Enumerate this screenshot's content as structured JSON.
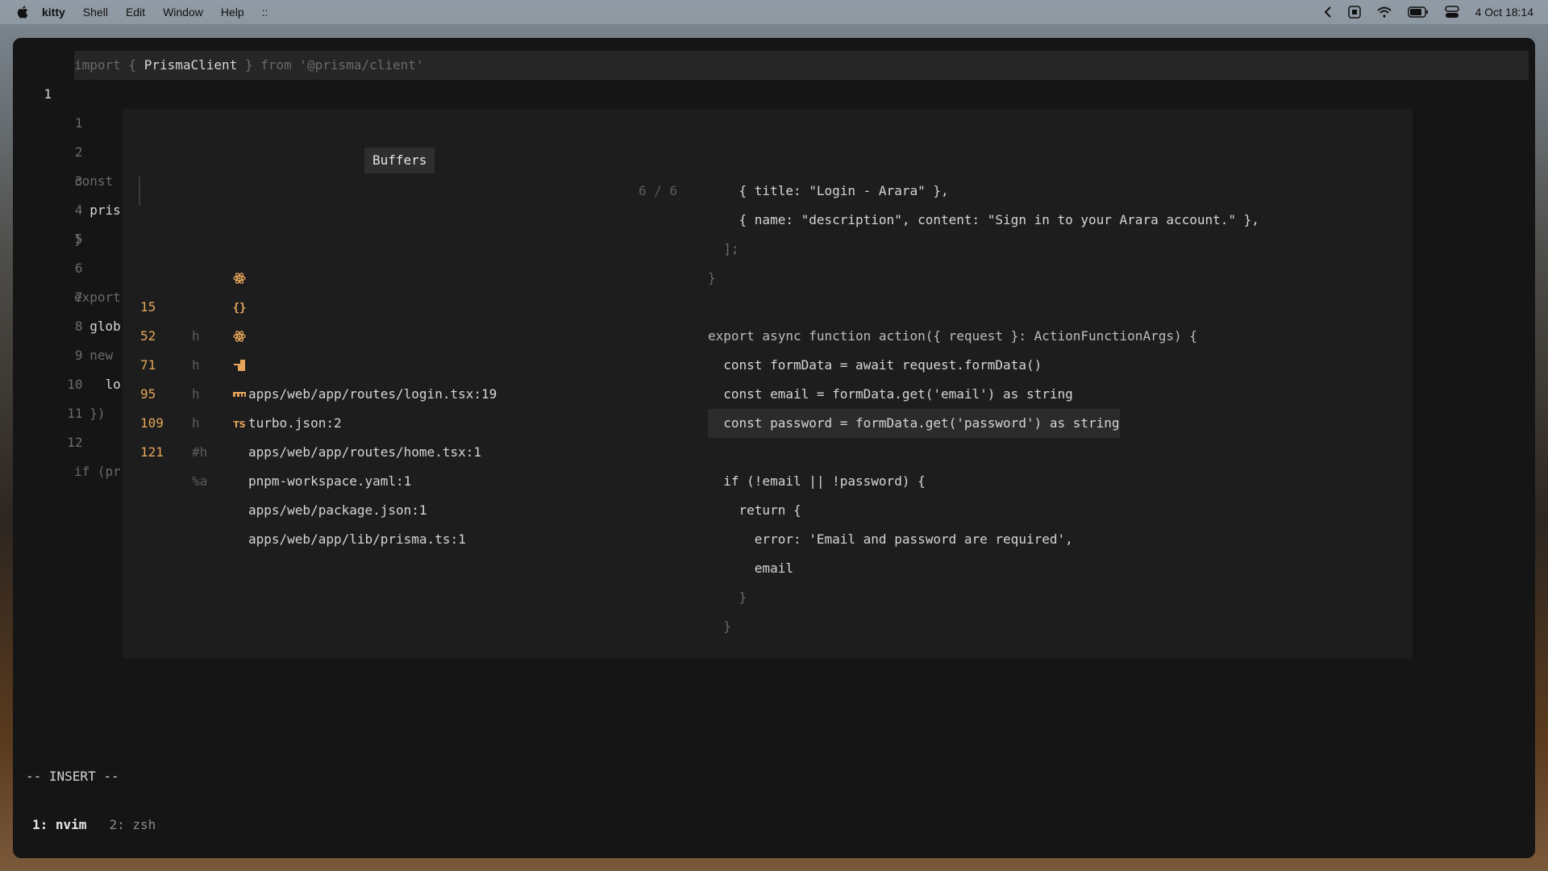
{
  "menubar": {
    "app": "kitty",
    "menus": [
      "Shell",
      "Edit",
      "Window",
      "Help",
      "::"
    ],
    "datetime": "4 Oct  18:14",
    "icons": [
      "chevron-left-icon",
      "screen-icon",
      "wifi-icon",
      "battery-icon",
      "control-center-icon"
    ]
  },
  "editor": {
    "top_line": {
      "number": "1",
      "text_a": "import { ",
      "text_b": "PrismaClient",
      "text_c": " } from '@prisma/client'"
    },
    "lines": [
      {
        "n": "1",
        "code": ""
      },
      {
        "n": "2",
        "code": "const"
      },
      {
        "n": "3",
        "code": "  pris"
      },
      {
        "n": "4",
        "code": "}"
      },
      {
        "n": "5",
        "code": ""
      },
      {
        "n": "6",
        "code": "export"
      },
      {
        "n": "7",
        "code": "  glob"
      },
      {
        "n": "8",
        "code": "  new"
      },
      {
        "n": "9",
        "code": "    lo"
      },
      {
        "n": "10",
        "code": "  })"
      },
      {
        "n": "11",
        "code": ""
      },
      {
        "n": "12",
        "code": "if (pr"
      }
    ]
  },
  "picker": {
    "title": "Buffers",
    "counter": "6 / 6",
    "buffers": [
      {
        "num": "15",
        "flag": "h",
        "name": "apps/web/app/routes/login.tsx:19",
        "icon": "react-icon"
      },
      {
        "num": "52",
        "flag": "h",
        "name": "turbo.json:2",
        "icon": "json-icon"
      },
      {
        "num": "71",
        "flag": "h",
        "name": "apps/web/app/routes/home.tsx:1",
        "icon": "react-icon"
      },
      {
        "num": "95",
        "flag": "h",
        "name": "pnpm-workspace.yaml:1",
        "icon": "pnpm-icon"
      },
      {
        "num": "109",
        "flag": "#h",
        "name": "apps/web/package.json:1",
        "icon": "npm-icon"
      },
      {
        "num": "121",
        "flag": "%a",
        "name": "apps/web/app/lib/prisma.ts:1",
        "icon": "typescript-icon"
      }
    ],
    "preview": [
      {
        "text": "    { title: \"Login - Arara\" },"
      },
      {
        "text": "    { name: \"description\", content: \"Sign in to your Arara account.\" },"
      },
      {
        "text": "  ];"
      },
      {
        "text": "}"
      },
      {
        "text": ""
      },
      {
        "text": "export async function action({ request }: ActionFunctionArgs) {"
      },
      {
        "text": "  const formData = await request.formData()"
      },
      {
        "text": "  const email = formData.get('email') as string"
      },
      {
        "text": "  const password = formData.get('password') as string"
      },
      {
        "text": ""
      },
      {
        "text": "  if (!email || !password) {"
      },
      {
        "text": "    return {"
      },
      {
        "text": "      error: 'Email and password are required',"
      },
      {
        "text": "      email"
      },
      {
        "text": "    }"
      },
      {
        "text": "  }"
      }
    ]
  },
  "status": {
    "mode": "-- INSERT --"
  },
  "tabs": [
    {
      "label": "1: nvim",
      "active": true
    },
    {
      "label": "2: zsh",
      "active": false
    }
  ],
  "colors": {
    "accent": "#e5a55a",
    "bg": "#151515",
    "picker_bg": "#1d1d1d"
  }
}
